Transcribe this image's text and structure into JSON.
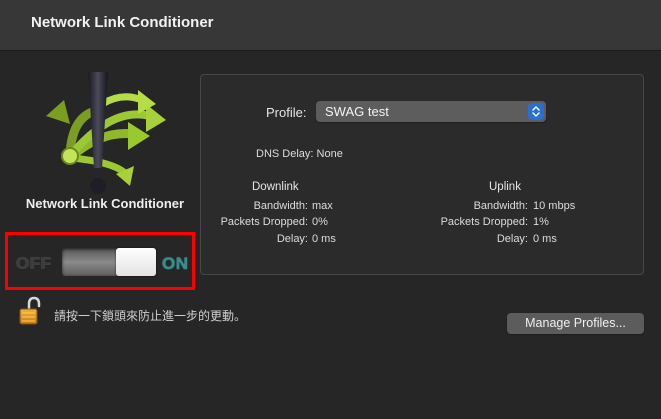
{
  "window": {
    "title": "Network Link Conditioner"
  },
  "app": {
    "logo_label": "Network Link Conditioner",
    "logo_icon": "exclamation-arrows-icon"
  },
  "toggle": {
    "off_label": "OFF",
    "on_label": "ON",
    "state": "on"
  },
  "profile": {
    "label": "Profile:",
    "selected": "SWAG test"
  },
  "dns": {
    "text": "DNS Delay: None"
  },
  "downlink": {
    "header": "Downlink",
    "bandwidth_label": "Bandwidth:",
    "bandwidth_value": "max",
    "packets_label": "Packets Dropped:",
    "packets_value": "0%",
    "delay_label": "Delay:",
    "delay_value": "0 ms"
  },
  "uplink": {
    "header": "Uplink",
    "bandwidth_label": "Bandwidth:",
    "bandwidth_value": "10 mbps",
    "packets_label": "Packets Dropped:",
    "packets_value": "1%",
    "delay_label": "Delay:",
    "delay_value": "0 ms"
  },
  "lock": {
    "icon": "open-lock-icon",
    "hint": "請按一下鎖頭來防止進一步的更動。"
  },
  "buttons": {
    "manage_profiles": "Manage Profiles..."
  },
  "colors": {
    "accent": "#2a6fd6",
    "highlight_box": "#ff0000",
    "on_label": "#2f8f8f"
  }
}
